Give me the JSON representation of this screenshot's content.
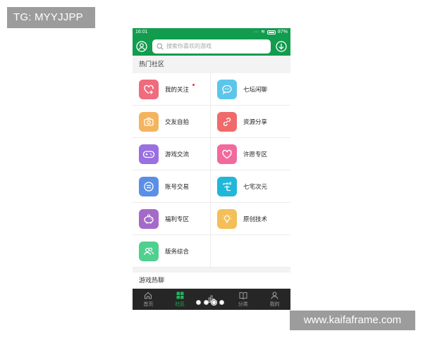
{
  "watermarks": {
    "top": "TG: MYYJJPP",
    "bottom": "www.kaifaframe.com"
  },
  "status_bar": {
    "time": "16:01",
    "battery": "87%"
  },
  "header": {
    "search_placeholder": "搜索你喜欢的游戏",
    "left_icon": "user-circle-icon",
    "right_icon": "download-icon"
  },
  "hot_community": {
    "title": "热门社区",
    "items": [
      {
        "label": "我的关注",
        "icon": "heart-plus-icon",
        "color": "#ef6b7d",
        "has_new": true
      },
      {
        "label": "七坛闲聊",
        "icon": "chat-bubble-icon",
        "color": "#5cc6ea",
        "has_new": false
      },
      {
        "label": "交友自拍",
        "icon": "camera-icon",
        "color": "#f4b45e",
        "has_new": false
      },
      {
        "label": "资源分享",
        "icon": "link-icon",
        "color": "#ef6b6b",
        "has_new": false
      },
      {
        "label": "游戏交流",
        "icon": "gamepad-icon",
        "color": "#9a6fe0",
        "has_new": false
      },
      {
        "label": "许愿专区",
        "icon": "heart-icon",
        "color": "#f26a9b",
        "has_new": false
      },
      {
        "label": "账号交易",
        "icon": "equals-circle-icon",
        "color": "#5b8fe6",
        "has_new": false
      },
      {
        "label": "七宅次元",
        "icon": "zhai-glyph-icon",
        "color": "#21b7d8",
        "has_new": false
      },
      {
        "label": "福利专区",
        "icon": "piggy-bank-icon",
        "color": "#a56ac9",
        "has_new": false
      },
      {
        "label": "原创技术",
        "icon": "lightbulb-icon",
        "color": "#f4be58",
        "has_new": false
      },
      {
        "label": "版务综合",
        "icon": "users-icon",
        "color": "#4fd08f",
        "has_new": false
      }
    ]
  },
  "game_chat": {
    "title": "游戏热聊"
  },
  "tabbar": {
    "tabs": [
      {
        "label": "首页",
        "icon": "home-icon",
        "active": false
      },
      {
        "label": "社区",
        "icon": "grid-icon",
        "active": true
      },
      {
        "label": "",
        "icon": "chart-icon",
        "active": false
      },
      {
        "label": "分类",
        "icon": "book-icon",
        "active": false
      },
      {
        "label": "我的",
        "icon": "person-icon",
        "active": false
      }
    ]
  },
  "pager": {
    "count": 4,
    "current": 3
  }
}
